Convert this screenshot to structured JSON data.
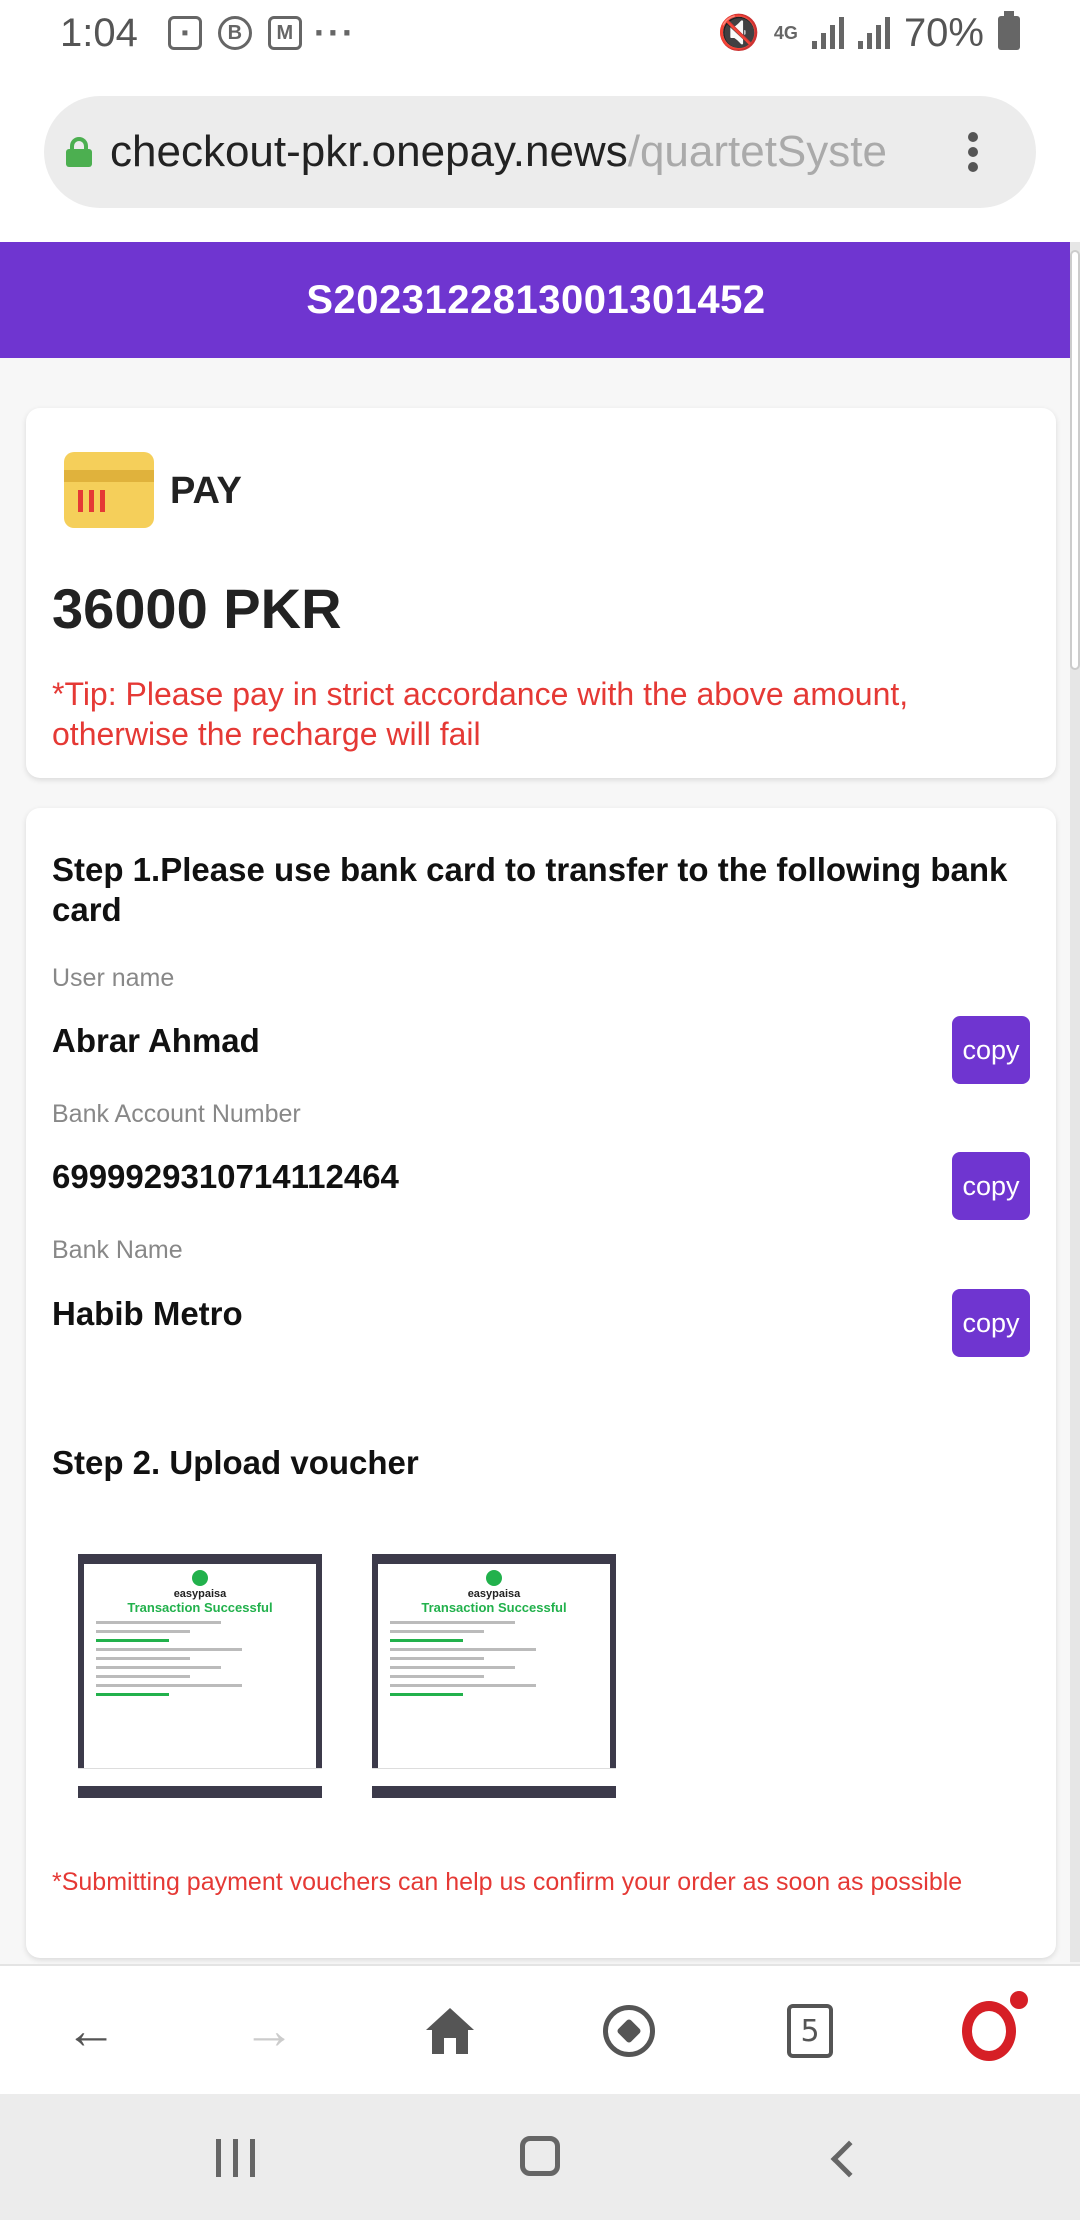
{
  "status_bar": {
    "time": "1:04",
    "battery": "70%",
    "network": "4G",
    "left_icons": [
      "image-icon",
      "b-icon",
      "gmail-icon",
      "more-icon"
    ]
  },
  "browser": {
    "url_domain": "checkout-pkr.onepay.news",
    "url_path": "/quartetSyste",
    "tab_count": "5"
  },
  "header": {
    "order_id": "S2023122813001301452"
  },
  "pay_card": {
    "label": "PAY",
    "amount": "36000 PKR",
    "tip": "*Tip: Please pay in strict accordance with the above amount, otherwise the recharge will fail"
  },
  "step1": {
    "title": "Step 1.Please use bank card to transfer to the following bank card",
    "fields": [
      {
        "label": "User name",
        "value": "Abrar Ahmad",
        "button": "copy"
      },
      {
        "label": "Bank Account Number",
        "value": "6999929310714112464",
        "button": "copy"
      },
      {
        "label": "Bank Name",
        "value": "Habib Metro",
        "button": "copy"
      }
    ]
  },
  "step2": {
    "title": "Step 2. Upload voucher",
    "vouchers": [
      {
        "brand": "easypaisa",
        "status": "Transaction Successful"
      },
      {
        "brand": "easypaisa",
        "status": "Transaction Successful"
      }
    ],
    "note": "*Submitting payment vouchers can help us confirm your order as soon as possible"
  },
  "colors": {
    "brand_purple": "#6f35d0",
    "warning_red": "#e53935",
    "success_green": "#22b14c"
  }
}
